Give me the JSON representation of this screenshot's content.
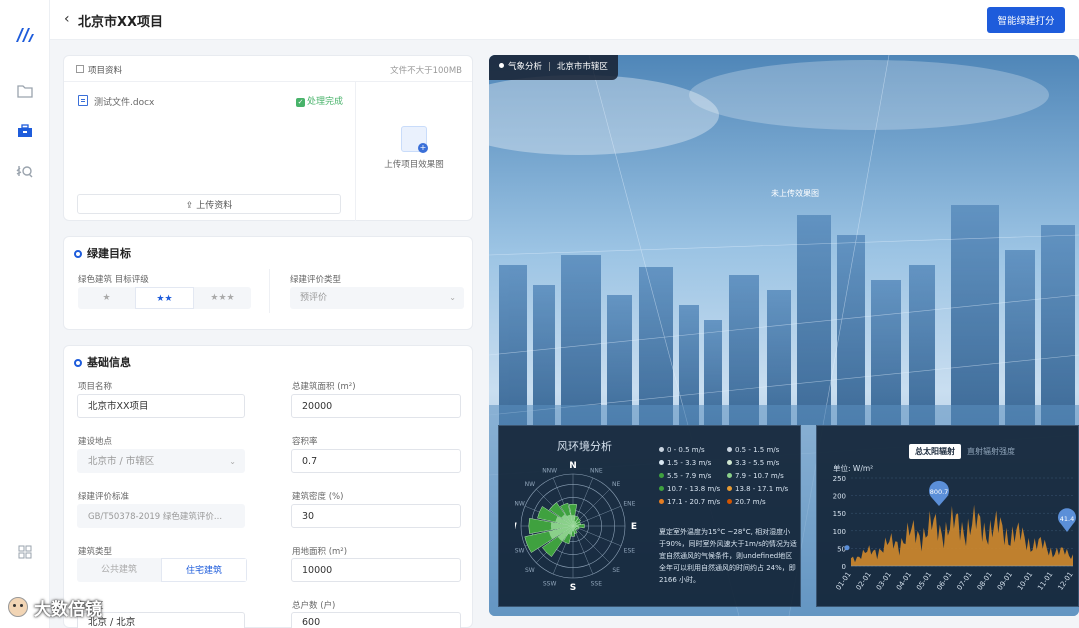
{
  "header": {
    "back_icon": "chevron-left-icon",
    "title": "北京市XX项目",
    "primary_button": "智能绿建打分"
  },
  "rail": {
    "items": [
      "logo",
      "folder-icon",
      "briefcase-icon",
      "knowledge-icon",
      "apps-grid-icon"
    ]
  },
  "upload": {
    "header_title": "项目资料",
    "size_hint": "文件不大于100MB",
    "file_name": "测试文件.docx",
    "file_status": "处理完成",
    "upload_button": "上传资料",
    "upload_image_label": "上传项目效果图"
  },
  "goal": {
    "title": "绿建目标",
    "rating_label": "绿色建筑 目标评级",
    "stars": [
      "★",
      "★★",
      "★★★"
    ],
    "selected_star_index": 1,
    "eval_type_label": "绿建评价类型",
    "eval_type_value": "预评价"
  },
  "basic": {
    "title": "基础信息",
    "project_name_label": "项目名称",
    "project_name_value": "北京市XX项目",
    "total_area_label": "总建筑面积 (m²)",
    "total_area_value": "20000",
    "location_label": "建设地点",
    "location_value": "北京市 / 市辖区",
    "plot_ratio_label": "容积率",
    "plot_ratio_value": "0.7",
    "standard_label": "绿建评价标准",
    "standard_value": "GB/T50378-2019 绿色建筑评价...",
    "density_label": "建筑密度 (%)",
    "density_value": "30",
    "building_type_label": "建筑类型",
    "building_types": [
      "公共建筑",
      "住宅建筑"
    ],
    "selected_building_type": 1,
    "land_area_label": "用地面积 (m²)",
    "land_area_value": "10000",
    "climate_label": "气候区",
    "climate_value": "北京 / 北京",
    "households_label": "总户数 (户)",
    "households_value": "600"
  },
  "hero": {
    "tag_left": "气象分析",
    "tag_right": "北京市市辖区",
    "no_image_text": "未上传效果图"
  },
  "wind": {
    "title": "风环境分析",
    "directions": [
      "N",
      "NNE",
      "NE",
      "ENE",
      "E",
      "ESE",
      "SE",
      "SSE",
      "S",
      "SSW",
      "SW",
      "WSW",
      "W",
      "WNW",
      "NW",
      "NNW"
    ],
    "legend": [
      {
        "label": "0 - 0.5 m/s",
        "color": "#c9d4e0"
      },
      {
        "label": "0.5 - 1.5 m/s",
        "color": "#c9d4e0"
      },
      {
        "label": "1.5 - 3.3 m/s",
        "color": "#d9e8f2"
      },
      {
        "label": "3.3 - 5.5 m/s",
        "color": "#cfe6cf"
      },
      {
        "label": "5.5 - 7.9 m/s",
        "color": "#3fa13f"
      },
      {
        "label": "7.9 - 10.7 m/s",
        "color": "#8ad08a"
      },
      {
        "label": "10.7 - 13.8 m/s",
        "color": "#3fa13f"
      },
      {
        "label": "13.8 - 17.1 m/s",
        "color": "#e69a33"
      },
      {
        "label": "17.1 - 20.7 m/s",
        "color": "#e67e22"
      },
      {
        "label": "20.7 m/s",
        "color": "#d35400"
      }
    ],
    "description": "夏定室外温度为15°C ~28°C, 相对湿度小于90%，同时室外风速大于1m/s的情况为适宜自然通风的气候条件，则undefined地区全年可以利用自然通风的时间约占 24%，即2166 小时。",
    "rose_petals": [
      0.42,
      0.2,
      0.18,
      0.15,
      0.22,
      0.12,
      0.1,
      0.15,
      0.2,
      0.35,
      0.72,
      0.95,
      0.85,
      0.7,
      0.55,
      0.45
    ]
  },
  "solar": {
    "tabs": [
      "总太阳辐射",
      "直射辐射强度"
    ],
    "active_tab": 0,
    "unit_label": "单位: W/m²",
    "peak_label": "800.7",
    "end_label": "41.4",
    "chart_data": {
      "type": "area",
      "ylim": [
        0,
        250
      ],
      "yticks": [
        0,
        50,
        100,
        150,
        200,
        250
      ],
      "categories": [
        "01-01",
        "02-01",
        "03-01",
        "04-01",
        "05-01",
        "06-01",
        "07-01",
        "08-01",
        "09-01",
        "10-01",
        "11-01",
        "12-01"
      ],
      "values": [
        22,
        40,
        62,
        88,
        105,
        112,
        115,
        108,
        92,
        66,
        45,
        30
      ]
    }
  }
}
